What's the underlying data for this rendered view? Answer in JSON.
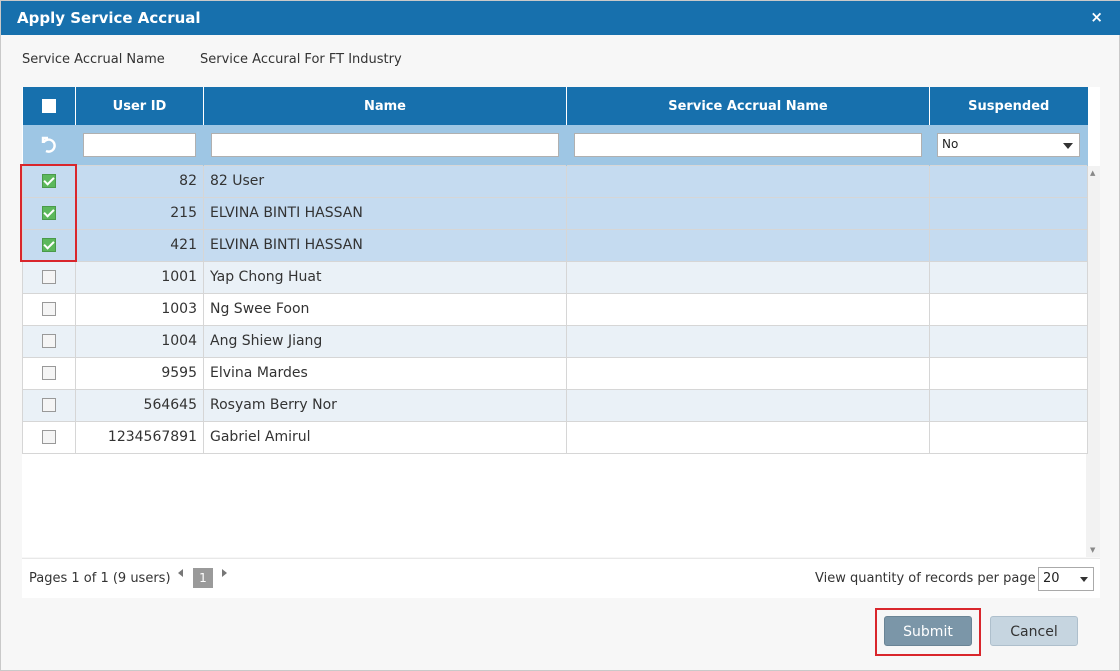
{
  "dialog": {
    "title": "Apply Service Accrual",
    "close_label": "×"
  },
  "accrual_field": {
    "label": "Service Accrual Name",
    "value": "Service Accural For FT Industry"
  },
  "grid": {
    "columns": [
      "User ID",
      "Name",
      "Service Accrual Name",
      "Suspended"
    ],
    "filter": {
      "suspended_selected": "No"
    },
    "rows": [
      {
        "checked": true,
        "user_id": "82",
        "name": "82 User",
        "accrual": "",
        "suspended": ""
      },
      {
        "checked": true,
        "user_id": "215",
        "name": "ELVINA BINTI HASSAN",
        "accrual": "",
        "suspended": ""
      },
      {
        "checked": true,
        "user_id": "421",
        "name": "ELVINA BINTI HASSAN",
        "accrual": "",
        "suspended": ""
      },
      {
        "checked": false,
        "user_id": "1001",
        "name": "Yap Chong Huat",
        "accrual": "",
        "suspended": ""
      },
      {
        "checked": false,
        "user_id": "1003",
        "name": "Ng Swee Foon",
        "accrual": "",
        "suspended": ""
      },
      {
        "checked": false,
        "user_id": "1004",
        "name": "Ang Shiew Jiang",
        "accrual": "",
        "suspended": ""
      },
      {
        "checked": false,
        "user_id": "9595",
        "name": "Elvina Mardes",
        "accrual": "",
        "suspended": ""
      },
      {
        "checked": false,
        "user_id": "564645",
        "name": "Rosyam Berry Nor",
        "accrual": "",
        "suspended": ""
      },
      {
        "checked": false,
        "user_id": "1234567891",
        "name": "Gabriel Amirul",
        "accrual": "",
        "suspended": ""
      }
    ]
  },
  "pagination": {
    "summary": "Pages 1 of 1 (9 users)",
    "current_page": "1",
    "per_page_label": "View quantity of records per page",
    "per_page_value": "20"
  },
  "buttons": {
    "submit": "Submit",
    "cancel": "Cancel"
  },
  "colors": {
    "header_blue": "#1770ad",
    "filter_row": "#9ec6e4",
    "selected_row": "#c5dbf0",
    "highlight_red": "#d9262c",
    "check_green": "#5cb85c"
  }
}
